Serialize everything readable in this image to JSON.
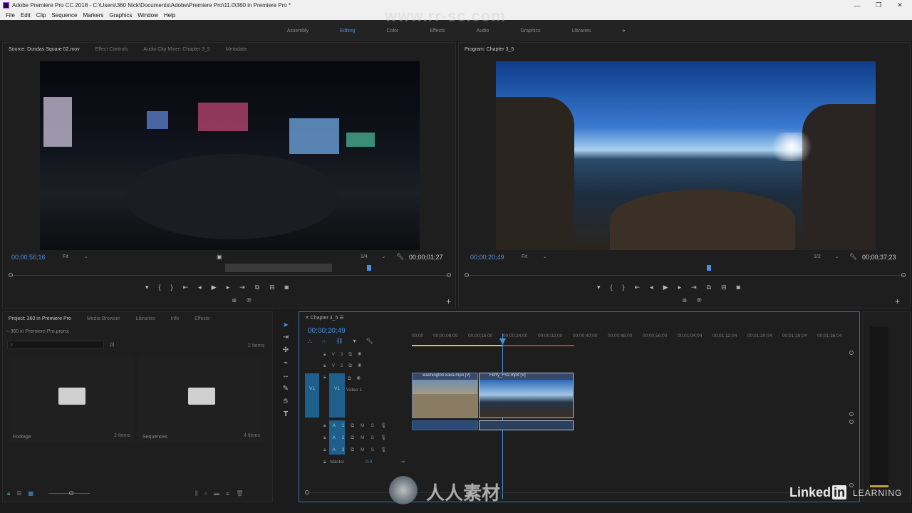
{
  "window": {
    "title": "Adobe Premiere Pro CC 2018 - C:\\Users\\360 Nick\\Documents\\Adobe\\Premiere Pro\\11.0\\360 in Premiere Pro *"
  },
  "watermark": "www.rr-sc.com",
  "menu": [
    "File",
    "Edit",
    "Clip",
    "Sequence",
    "Markers",
    "Graphics",
    "Window",
    "Help"
  ],
  "workspaces": {
    "items": [
      "Assembly",
      "Editing",
      "Color",
      "Effects",
      "Audio",
      "Graphics",
      "Libraries"
    ],
    "active": "Editing",
    "more": "»"
  },
  "source": {
    "tabs": [
      "Source: Dundas Square 02.mov",
      "Effect Controls",
      "Audio Clip Mixer: Chapter 3_5",
      "Metadata"
    ],
    "timecode": "00;00;56;16",
    "fit": "Fit",
    "resolution": "1/4",
    "duration": "00;00;01;27"
  },
  "program": {
    "tab": "Program: Chapter 3_5",
    "timecode": "00;00;20;49",
    "fit": "Fit",
    "resolution": "1/2",
    "duration": "00;00;37;23"
  },
  "transport_icons": [
    "marker-icon",
    "in-point-icon",
    "out-point-icon",
    "go-to-in-icon",
    "step-back-icon",
    "play-icon",
    "step-forward-icon",
    "go-to-out-icon",
    "insert-icon",
    "overwrite-icon",
    "export-frame-icon"
  ],
  "project": {
    "tabs": [
      "Project: 360 in Premiere Pro",
      "Media Browser",
      "Libraries",
      "Info",
      "Effects"
    ],
    "file": "360 in Premiere Pro.prproj",
    "item_count": "2 Items",
    "bins": [
      {
        "name": "Footage",
        "count": "2 Items"
      },
      {
        "name": "Sequences",
        "count": "4 Items"
      }
    ]
  },
  "timeline": {
    "tab": "Chapter 3_5",
    "timecode": "00;00;20;49",
    "ruler": [
      "00;00",
      "00;00;08;00",
      "00;00;16;00",
      "00;00;24;00",
      "00;00;32;00",
      "00;00;40;00",
      "00;00;48;00",
      "00;00;56;00",
      "00;01;04;04",
      "00;01;12;04",
      "00;01;20;04",
      "00;01;28;04",
      "00;01;36;04"
    ],
    "video_tracks": [
      "V3",
      "V2",
      "V1"
    ],
    "v1_label": "Video 1",
    "v1_source": "V1",
    "audio_tracks": [
      "A1",
      "A2",
      "A3"
    ],
    "audio_buttons": [
      "M",
      "S"
    ],
    "master": "Master",
    "master_value": "0.0",
    "clips": [
      {
        "name": "washington.kava.mp4 [V]"
      },
      {
        "name": "Ferry_FS2.mp4 [V]"
      }
    ]
  },
  "branding": {
    "linkedin": "Linked",
    "in": "in",
    "learning": "LEARNING",
    "cn": "人人素材"
  },
  "colors": {
    "accent": "#4a8fe0",
    "track_blue": "#1f5f8c"
  }
}
